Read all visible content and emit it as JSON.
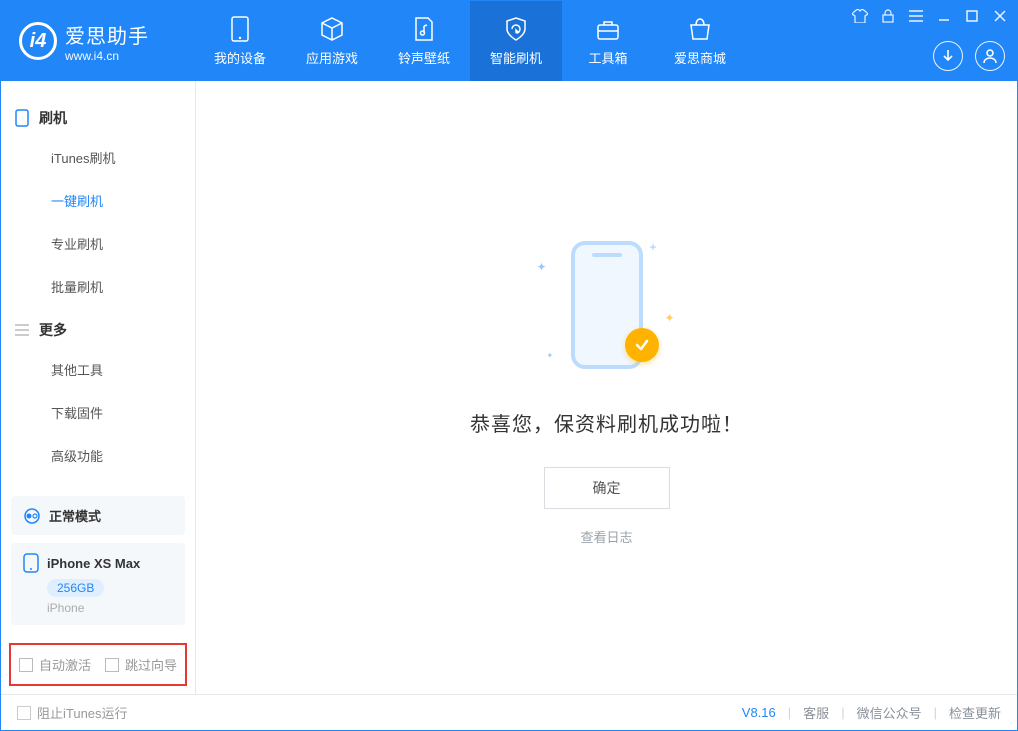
{
  "brand": {
    "name": "爱思助手",
    "url": "www.i4.cn"
  },
  "nav": {
    "my_device": "我的设备",
    "apps_games": "应用游戏",
    "ring_wall": "铃声壁纸",
    "smart_flash": "智能刷机",
    "toolbox": "工具箱",
    "store": "爱思商城"
  },
  "sidebar": {
    "flash_section": "刷机",
    "items": {
      "itunes": "iTunes刷机",
      "oneclick": "一键刷机",
      "pro": "专业刷机",
      "batch": "批量刷机"
    },
    "more_section": "更多",
    "more_items": {
      "other_tools": "其他工具",
      "download_fw": "下载固件",
      "advanced": "高级功能"
    },
    "mode_panel": {
      "label": "正常模式"
    },
    "device_panel": {
      "name": "iPhone XS Max",
      "storage": "256GB",
      "type": "iPhone"
    },
    "options": {
      "auto_activate": "自动激活",
      "skip_guide": "跳过向导"
    }
  },
  "main": {
    "result": "恭喜您，保资料刷机成功啦！",
    "confirm": "确定",
    "view_log": "查看日志"
  },
  "status": {
    "block_itunes": "阻止iTunes运行",
    "version": "V8.16",
    "support": "客服",
    "wechat": "微信公众号",
    "update": "检查更新"
  }
}
